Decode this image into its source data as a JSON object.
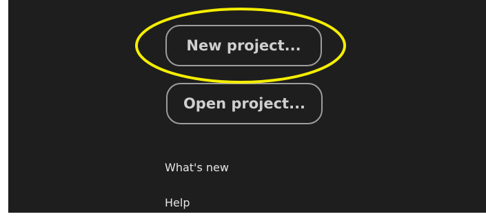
{
  "start_panel": {
    "new_project_label": "New project...",
    "open_project_label": "Open project...",
    "links": {
      "whats_new": "What's new",
      "help": "Help"
    }
  },
  "annotation": {
    "highlight_color": "#f5ee00",
    "highlighted_element": "new-project-button"
  },
  "colors": {
    "background": "#1e1e1e",
    "button_border": "#9e9e9e",
    "button_text": "#cfcfcf",
    "link_text": "#e6e6e6"
  }
}
